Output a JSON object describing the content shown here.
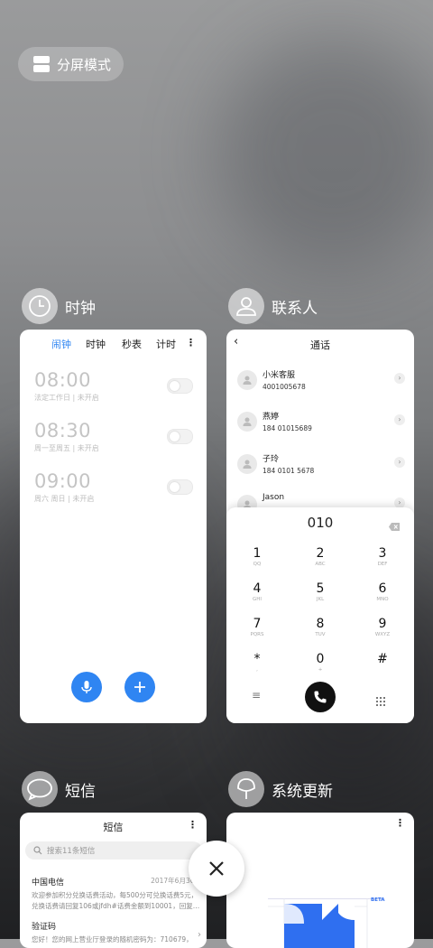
{
  "split_mode": {
    "label": "分屏模式"
  },
  "apps": {
    "clock": {
      "name": "时钟",
      "tabs": [
        "闹钟",
        "时钟",
        "秒表",
        "计时"
      ],
      "active_tab": "闹钟",
      "alarms": [
        {
          "time": "08:00",
          "detail": "法定工作日 | 未开启"
        },
        {
          "time": "08:30",
          "detail": "周一至周五 | 未开启"
        },
        {
          "time": "09:00",
          "detail": "周六 周日 | 未开启"
        }
      ]
    },
    "contacts": {
      "name": "联系人",
      "title": "通话",
      "list": [
        {
          "name": "小米客服",
          "number": "4001005678"
        },
        {
          "name": "燕婷",
          "number": "184 01015689"
        },
        {
          "name": "子玲",
          "number": "184 0101 5678"
        },
        {
          "name": "Jason",
          "number": ""
        }
      ],
      "dial_input": "010",
      "keys": [
        {
          "d": "1",
          "l": "QQ"
        },
        {
          "d": "2",
          "l": "ABC"
        },
        {
          "d": "3",
          "l": "DEF"
        },
        {
          "d": "4",
          "l": "GHI"
        },
        {
          "d": "5",
          "l": "JKL"
        },
        {
          "d": "6",
          "l": "MNO"
        },
        {
          "d": "7",
          "l": "PQRS"
        },
        {
          "d": "8",
          "l": "TUV"
        },
        {
          "d": "9",
          "l": "WXYZ"
        },
        {
          "d": "*",
          "l": ","
        },
        {
          "d": "0",
          "l": "+"
        },
        {
          "d": "#",
          "l": ""
        }
      ]
    },
    "sms": {
      "name": "短信",
      "title": "短信",
      "search_placeholder": "搜索11条短信",
      "messages": [
        {
          "sender": "中国电信",
          "date": "2017年6月30日",
          "line1": "欢迎参加积分兑换话费活动，每500分可兑换话费5元，",
          "line2": "兑换话费请回复106或jfdh#话费金额到10001，回复…"
        },
        {
          "sender": "验证码",
          "date": "",
          "line1": "您好！您的网上营业厅登录的随机密码为：710679，有",
          "line2": ""
        }
      ]
    },
    "update": {
      "name": "系统更新",
      "badge": "BETA"
    }
  },
  "colors": {
    "accent": "#2f85f2",
    "call": "#111111",
    "beta_blue": "#2f6ff0"
  }
}
